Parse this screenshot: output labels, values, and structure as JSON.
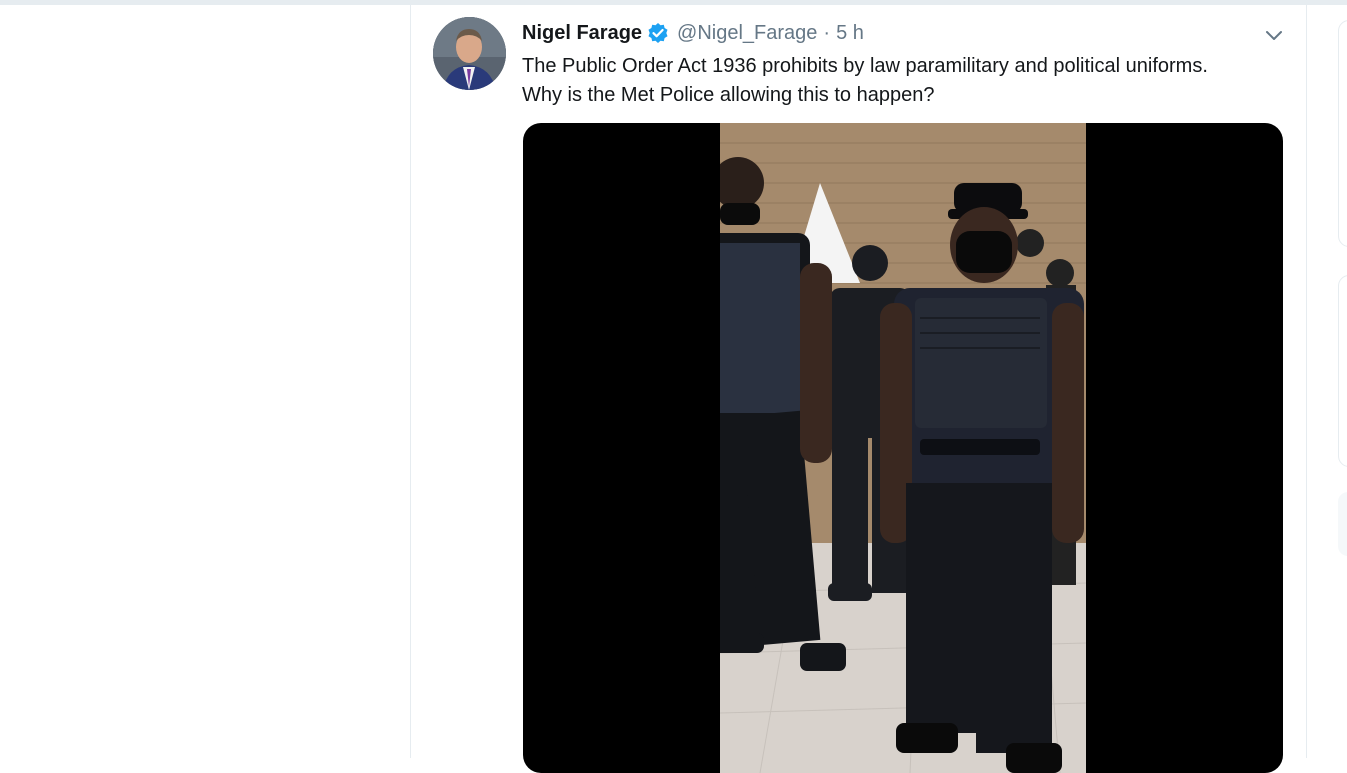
{
  "tweet": {
    "author_name": "Nigel Farage",
    "verified": true,
    "handle": "@Nigel_Farage",
    "separator": "·",
    "time": "5 h",
    "text": "The Public Order Act 1936 prohibits by law paramilitary and political uniforms. Why is the Met Police allowing this to happen?",
    "media_type": "video"
  },
  "icons": {
    "verified": "verified-badge-icon",
    "more": "chevron-down-icon"
  },
  "colors": {
    "verified_blue": "#1da1f2",
    "text": "#14171a",
    "secondary_text": "#657786",
    "divider": "#e6ecf0"
  }
}
